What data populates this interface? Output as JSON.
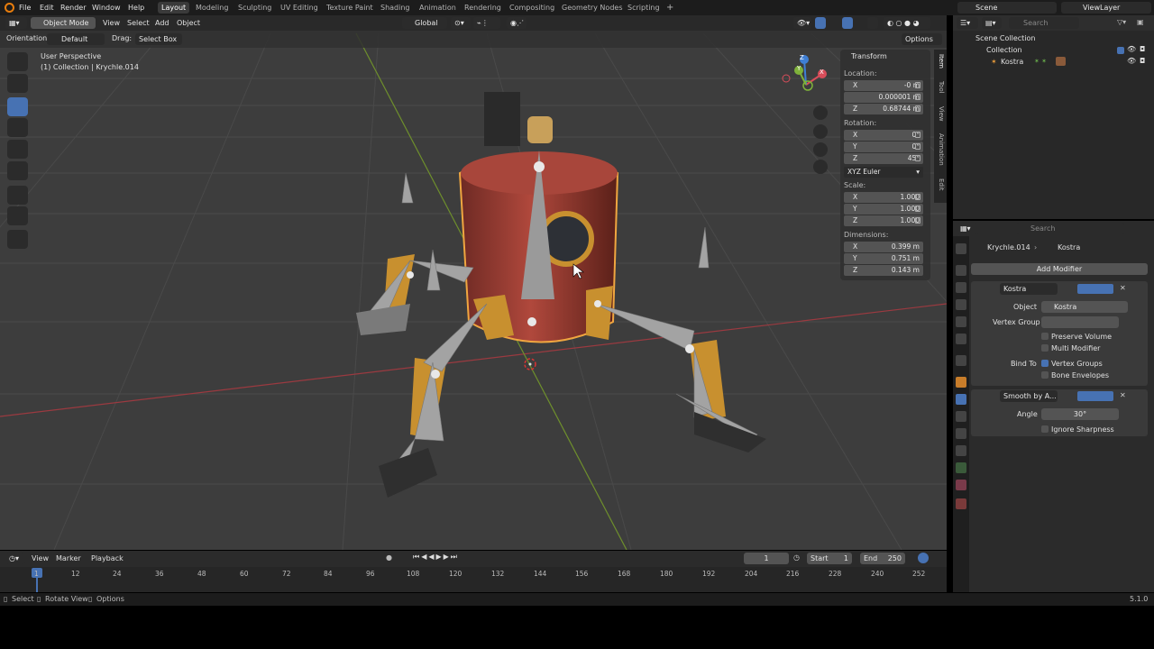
{
  "menu": [
    "File",
    "Edit",
    "Render",
    "Window",
    "Help"
  ],
  "workspaces": [
    "Layout",
    "Modeling",
    "Sculpting",
    "UV Editing",
    "Texture Paint",
    "Shading",
    "Animation",
    "Rendering",
    "Compositing",
    "Geometry Nodes",
    "Scripting"
  ],
  "scene": "Scene",
  "viewlayer": "ViewLayer",
  "viewport": {
    "mode": "Object Mode",
    "menus": [
      "View",
      "Select",
      "Add",
      "Object"
    ],
    "orientation_label": "Orientation:",
    "orientation_value": "Default",
    "drag_label": "Drag:",
    "drag_value": "Select Box",
    "transform_orient": "Global",
    "options": "Options",
    "overlay_title": "User Perspective",
    "overlay_sub": "(1) Collection | Krychle.014",
    "gizmo": {
      "x": "X",
      "y": "Y",
      "z": "Z"
    }
  },
  "npanel": {
    "title": "Transform",
    "location_label": "Location:",
    "location": [
      {
        "k": "X",
        "v": "-0 m"
      },
      {
        "k": "",
        "v": "0.000001 m"
      },
      {
        "k": "Z",
        "v": "0.68744 m"
      }
    ],
    "rotation_label": "Rotation:",
    "rotation": [
      {
        "k": "X",
        "v": "0°"
      },
      {
        "k": "Y",
        "v": "0°"
      },
      {
        "k": "Z",
        "v": "45°"
      }
    ],
    "rotation_mode": "XYZ Euler",
    "scale_label": "Scale:",
    "scale": [
      {
        "k": "X",
        "v": "1.000"
      },
      {
        "k": "Y",
        "v": "1.000"
      },
      {
        "k": "Z",
        "v": "1.000"
      }
    ],
    "dimensions_label": "Dimensions:",
    "dimensions": [
      {
        "k": "X",
        "v": "0.399 m"
      },
      {
        "k": "Y",
        "v": "0.751 m"
      },
      {
        "k": "Z",
        "v": "0.143 m"
      }
    ],
    "tabs": [
      "Item",
      "Tool",
      "View",
      "Animation",
      "Edit"
    ]
  },
  "outliner": {
    "search_placeholder": "Search",
    "root": "Scene Collection",
    "collection": "Collection",
    "object": "Kostra"
  },
  "props": {
    "search_placeholder": "Search",
    "breadcrumb_obj": "Krychle.014",
    "breadcrumb_mod": "Kostra",
    "add_modifier": "Add Modifier",
    "mod1_name": "Kostra",
    "object_label": "Object",
    "object_value": "Kostra",
    "vgroup_label": "Vertex Group",
    "preserve_volume": "Preserve Volume",
    "multi_modifier": "Multi Modifier",
    "bind_to_label": "Bind To",
    "vertex_groups": "Vertex Groups",
    "bone_envelopes": "Bone Envelopes",
    "mod2_name": "Smooth by A...",
    "angle_label": "Angle",
    "angle_value": "30°",
    "ignore_sharpness": "Ignore Sharpness"
  },
  "timeline": {
    "menus": [
      "View",
      "Marker",
      "Playback"
    ],
    "current_frame": "1",
    "start_label": "Start",
    "start": "1",
    "end_label": "End",
    "end": "250",
    "ticks": [
      "1",
      "12",
      "24",
      "36",
      "48",
      "60",
      "72",
      "84",
      "96",
      "108",
      "120",
      "132",
      "144",
      "156",
      "168",
      "180",
      "192",
      "204",
      "216",
      "228",
      "240",
      "252"
    ]
  },
  "status": {
    "select": "Select",
    "rotate": "Rotate View",
    "options": "Options",
    "version": "5.1.0"
  },
  "colors": {
    "accent": "#4772b3",
    "x_axis": "#d94d5a",
    "y_axis": "#7fb23a",
    "z_axis": "#3f7fd4"
  }
}
